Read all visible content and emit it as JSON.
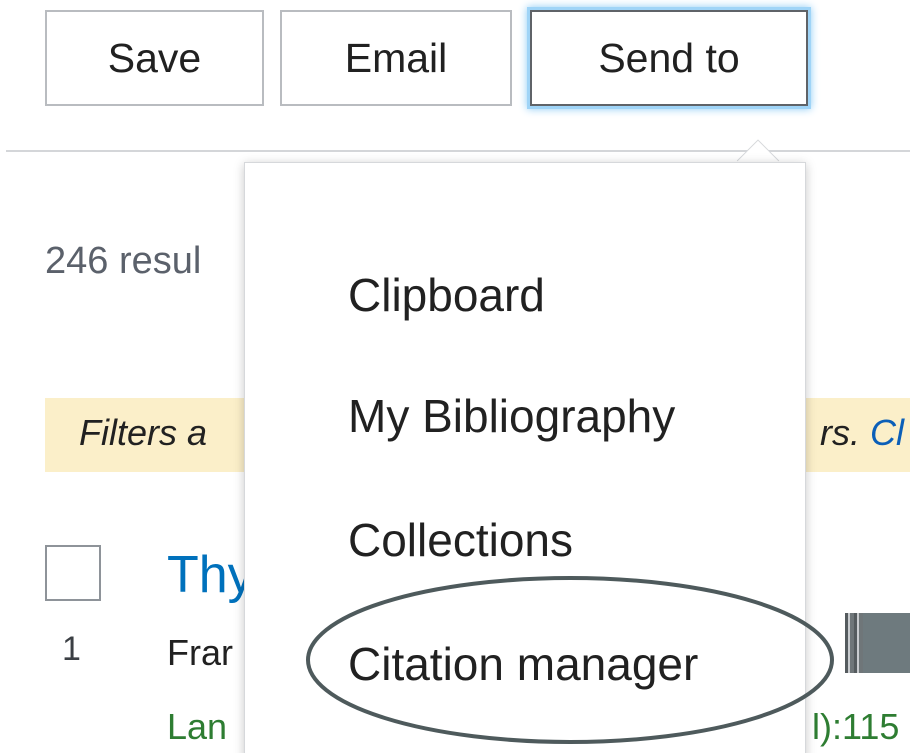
{
  "toolbar": {
    "save_label": "Save",
    "email_label": "Email",
    "send_to_label": "Send to"
  },
  "results": {
    "count_partial": "246 resul",
    "filter_banner_left": "Filters a",
    "filter_banner_right_text": "rs. ",
    "filter_banner_right_link": "Cl"
  },
  "result_item": {
    "number": "1",
    "title_partial": "Thy",
    "authors_partial": "Frar",
    "journal_partial": "Lan",
    "journal_tail": "l):115"
  },
  "send_to_menu": {
    "items": [
      {
        "label": "Clipboard"
      },
      {
        "label": "My Bibliography"
      },
      {
        "label": "Collections"
      },
      {
        "label": "Citation manager"
      }
    ]
  },
  "colors": {
    "link_blue": "#0071bc",
    "journal_green": "#2e7d32",
    "banner_yellow": "#fbefc9",
    "focus_ring": "#9fd4f7",
    "annotation_ellipse": "#4e5a5c"
  },
  "icons": {
    "thumbnail": "figure-thumbnail-icon"
  }
}
